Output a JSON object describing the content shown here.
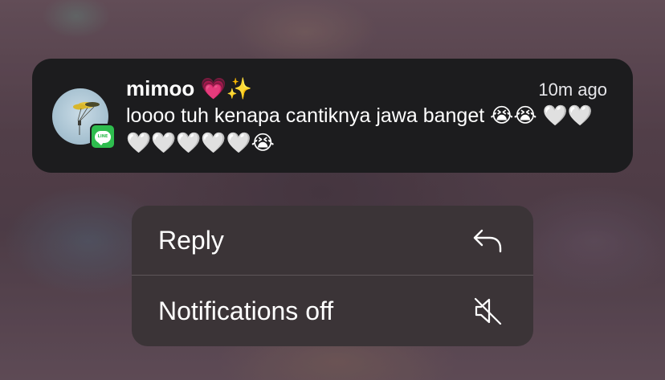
{
  "notification": {
    "sender": "mimoo 💗✨",
    "timestamp": "10m ago",
    "message": "loooo tuh kenapa cantiknya jawa banget 😭😭 🤍🤍🤍🤍🤍🤍🤍😭",
    "app_badge_text": "LINE",
    "app_color": "#2EBD4E"
  },
  "menu": {
    "items": [
      {
        "label": "Reply",
        "icon": "reply-arrow-icon"
      },
      {
        "label": "Notifications off",
        "icon": "speaker-muted-icon"
      }
    ]
  }
}
